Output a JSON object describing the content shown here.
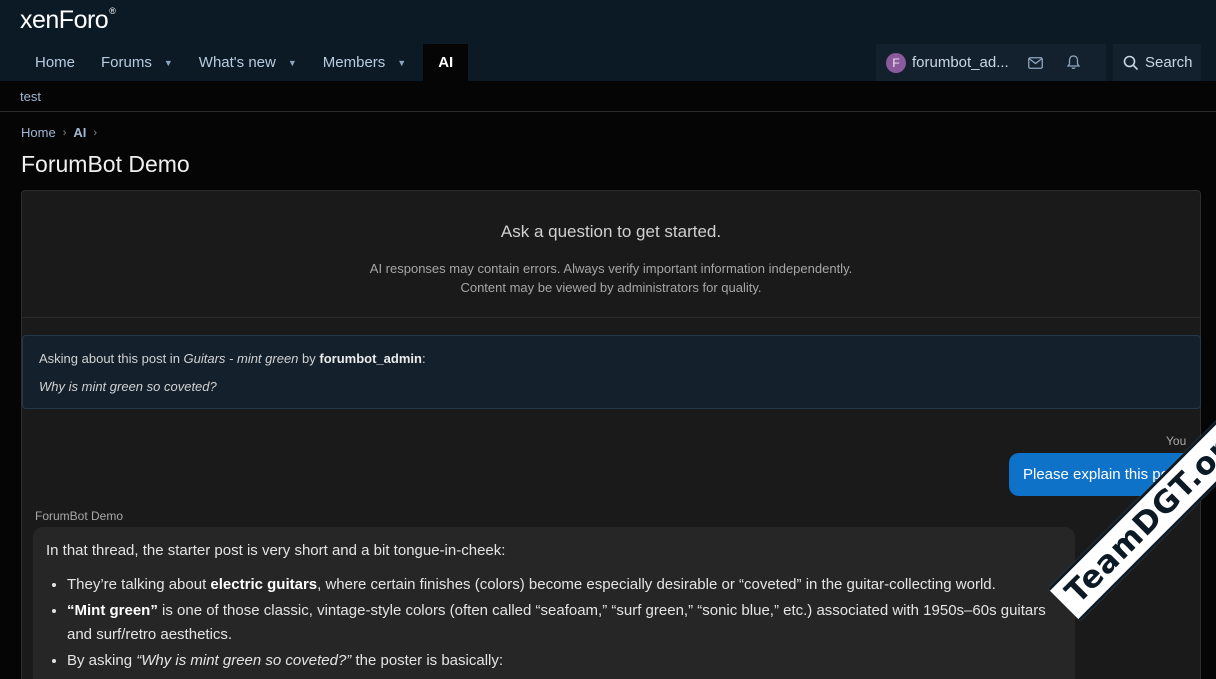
{
  "brand": {
    "logo_text": "xenForo",
    "logo_mark": "®"
  },
  "nav": {
    "tabs": [
      {
        "label": "Home"
      },
      {
        "label": "Forums"
      },
      {
        "label": "What's new"
      },
      {
        "label": "Members"
      },
      {
        "label": "AI"
      }
    ],
    "user": {
      "initial": "F",
      "name": "forumbot_ad..."
    },
    "search_label": "Search"
  },
  "subnav": {
    "link": "test"
  },
  "breadcrumb": {
    "items": [
      "Home",
      "AI"
    ]
  },
  "page": {
    "title": "ForumBot Demo"
  },
  "intro": {
    "title": "Ask a question to get started.",
    "note_line1": "AI responses may contain errors. Always verify important information independently.",
    "note_line2": "Content may be viewed by administrators for quality."
  },
  "context": {
    "prefix": "Asking about this post in ",
    "thread": "Guitars - mint green",
    "by": " by ",
    "author": "forumbot_admin",
    "colon": ":",
    "question": "Why is mint green so coveted?"
  },
  "chat": {
    "you_label": "You",
    "user_message": "Please explain this post",
    "bot_label": "ForumBot Demo",
    "bot_intro": "In that thread, the starter post is very short and a bit tongue-in-cheek:",
    "bullet1_pre": "They’re talking about ",
    "bullet1_bold": "electric guitars",
    "bullet1_post": ", where certain finishes (colors) become especially desirable or “coveted” in the guitar-collecting world.",
    "bullet2_bold": "“Mint green”",
    "bullet2_post": " is one of those classic, vintage-style colors (often called “seafoam,” “surf green,” “sonic blue,” etc.) associated with 1950s–60s guitars and surf/retro aesthetics.",
    "bullet3_pre": "By asking ",
    "bullet3_em": "“Why is mint green so coveted?”",
    "bullet3_post": " the poster is basically:"
  },
  "watermark": {
    "text": "TeamDGT.org"
  },
  "colors": {
    "header_bg": "#0c1a26",
    "accent": "#0f72c9",
    "link": "#9fb8d2"
  }
}
